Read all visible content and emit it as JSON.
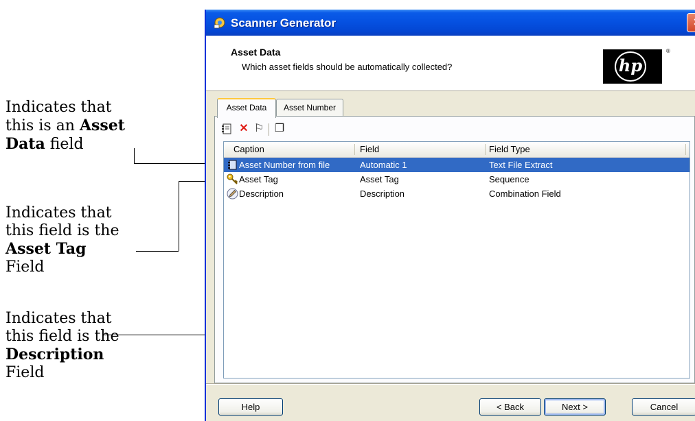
{
  "annotations": [
    {
      "lines": [
        "Indicates that",
        "this is an ",
        "Asset",
        "Data",
        " field"
      ]
    },
    {
      "lines": [
        "Indicates that",
        "this field is the",
        "Asset Tag",
        "Field"
      ]
    },
    {
      "lines": [
        "Indicates that",
        "this field is the",
        "Description",
        "Field"
      ]
    }
  ],
  "window": {
    "title": "Scanner Generator",
    "close_label": "×"
  },
  "header": {
    "title": "Asset Data",
    "subtitle": "Which asset fields should be automatically collected?",
    "logo_text": "hp",
    "logo_reg": "®"
  },
  "tabs": [
    {
      "label": "Asset Data",
      "active": true
    },
    {
      "label": "Asset Number",
      "active": false
    }
  ],
  "toolbar": {
    "icons": [
      "asset-data-icon",
      "delete-icon",
      "flag-icon",
      "copy-icon"
    ],
    "delete_glyph": "✕",
    "flag_glyph": "⚐",
    "copy_glyph": "❐"
  },
  "list": {
    "columns": [
      "Caption",
      "Field",
      "Field Type"
    ],
    "rows": [
      {
        "caption": "Asset Number from file",
        "field": "Automatic 1",
        "type": "Text File Extract",
        "icon": "asset-data-icon",
        "selected": true
      },
      {
        "caption": "Asset Tag",
        "field": "Asset Tag",
        "type": "Sequence",
        "icon": "key-icon",
        "selected": false
      },
      {
        "caption": "Description",
        "field": "Description",
        "type": "Combination Field",
        "icon": "pencil-icon",
        "selected": false
      }
    ]
  },
  "buttons": {
    "help": "Help",
    "back": "< Back",
    "next": "Next >",
    "cancel": "Cancel"
  },
  "colors": {
    "selection": "#316ac5",
    "titlebar": "#0550e0"
  }
}
